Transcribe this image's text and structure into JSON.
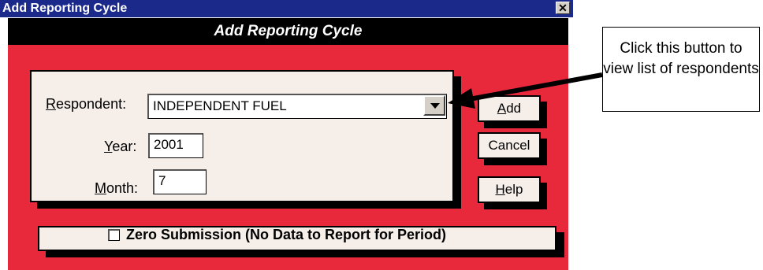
{
  "window": {
    "title": "Add Reporting Cycle",
    "close_glyph": "✕"
  },
  "header": {
    "title": "Add Reporting Cycle"
  },
  "form": {
    "respondent": {
      "label_first": "R",
      "label_rest": "espondent:",
      "value": "INDEPENDENT FUEL"
    },
    "year": {
      "label_first": "Y",
      "label_rest": "ear:",
      "value": "2001"
    },
    "month": {
      "label_first": "M",
      "label_rest": "onth:",
      "value": "7"
    }
  },
  "buttons": {
    "add": {
      "first": "A",
      "rest": "dd"
    },
    "cancel": {
      "label": "Cancel"
    },
    "help": {
      "first": "H",
      "rest": "elp"
    }
  },
  "zero_submission": {
    "label": "Zero Submission (No Data to Report for Period)",
    "checked": false
  },
  "callout": {
    "text": "Click this button to view list of respondents"
  },
  "colors": {
    "titlebar": "#1b2a8a",
    "red_area": "#e8293b",
    "panel": "#f6efe9"
  }
}
